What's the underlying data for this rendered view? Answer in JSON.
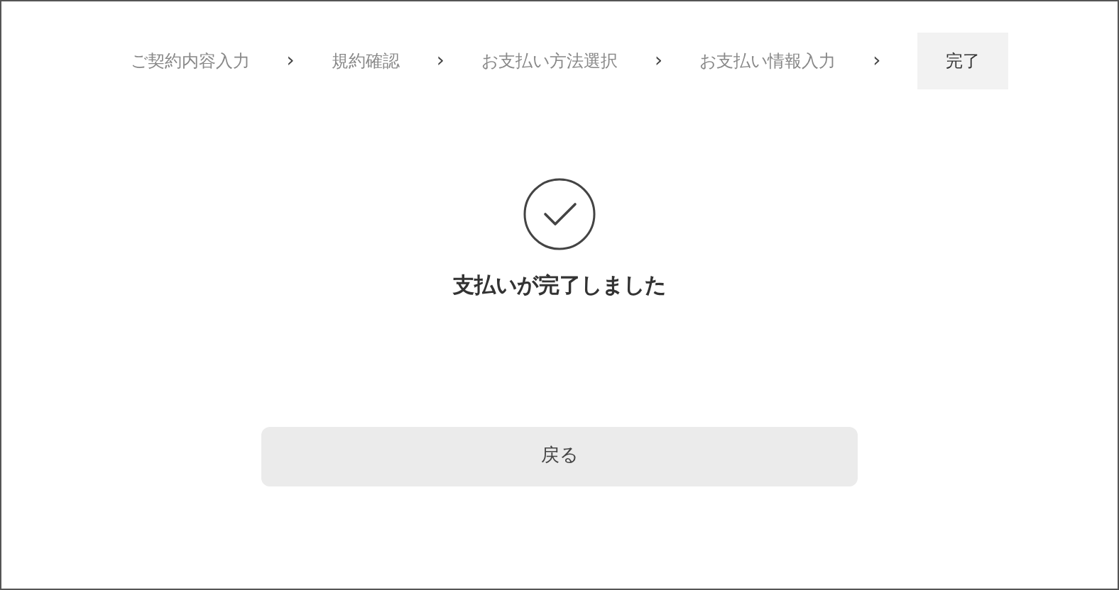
{
  "steps": [
    {
      "label": "ご契約内容入力",
      "selected": false,
      "separator": "›"
    },
    {
      "label": "規約確認",
      "selected": false,
      "separator": "›"
    },
    {
      "label": "お支払い方法選択",
      "selected": false,
      "separator": "›"
    },
    {
      "label": "お支払い情報入力",
      "selected": false,
      "separator": "›"
    },
    {
      "label": "完了",
      "selected": true
    }
  ],
  "message": "支払いが完了しました",
  "back_button": "戻る"
}
